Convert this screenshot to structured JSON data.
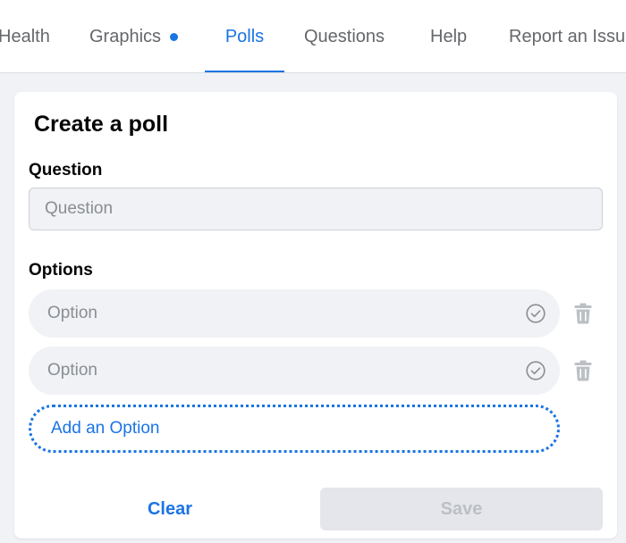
{
  "tabs": [
    {
      "label": "Health",
      "active": false
    },
    {
      "label": "Graphics",
      "active": false,
      "has_dot": true
    },
    {
      "label": "Polls",
      "active": true
    },
    {
      "label": "Questions",
      "active": false
    },
    {
      "label": "Help",
      "active": false
    },
    {
      "label": "Report an Issue",
      "active": false
    }
  ],
  "poll": {
    "title": "Create a poll",
    "question_label": "Question",
    "question_placeholder": "Question",
    "options_label": "Options",
    "options": [
      {
        "placeholder": "Option"
      },
      {
        "placeholder": "Option"
      }
    ],
    "add_option_label": "Add an Option",
    "clear_label": "Clear",
    "save_label": "Save"
  },
  "icons": {
    "option_confirm": "check-circle-icon",
    "option_delete": "trash-icon",
    "tab_indicator": "dot-icon"
  },
  "colors": {
    "accent": "#1b74e4",
    "muted_text": "#65676b",
    "field_bg": "#f0f2f5",
    "disabled_bg": "#e4e6eb",
    "disabled_text": "#bcc0c4"
  }
}
